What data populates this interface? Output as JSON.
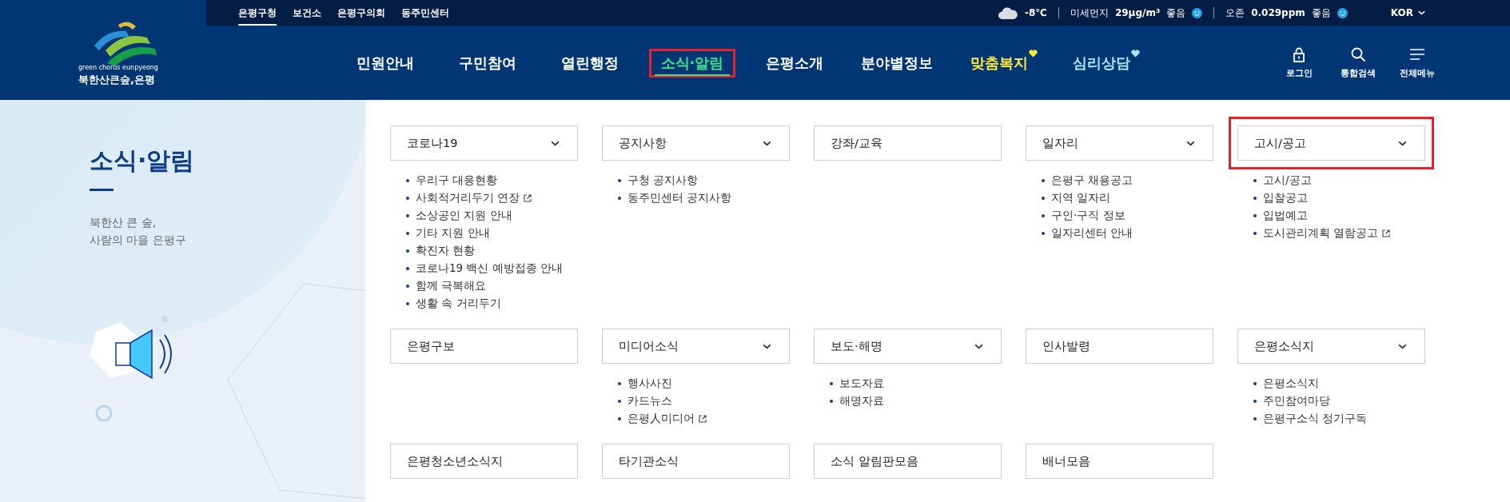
{
  "logo": {
    "tagline": "green chorus eunpyeong",
    "name": "북한산큰숲,은평"
  },
  "top_links": [
    {
      "label": "은평구청",
      "selected": true
    },
    {
      "label": "보건소",
      "selected": false
    },
    {
      "label": "은평구의회",
      "selected": false
    },
    {
      "label": "동주민센터",
      "selected": false
    }
  ],
  "status": {
    "temperature": "-8℃",
    "dust_label": "미세먼지",
    "dust_value": "29μg/m³",
    "dust_grade": "좋음",
    "ozone_label": "오존",
    "ozone_value": "0.029ppm",
    "ozone_grade": "좋음",
    "language": "KOR"
  },
  "nav": [
    {
      "label": "민원안내",
      "selected": false,
      "highlighted": false,
      "color": "#ffffff",
      "heart": false
    },
    {
      "label": "구민참여",
      "selected": false,
      "highlighted": false,
      "color": "#ffffff",
      "heart": false
    },
    {
      "label": "열린행정",
      "selected": false,
      "highlighted": false,
      "color": "#ffffff",
      "heart": false
    },
    {
      "label": "소식·알림",
      "selected": true,
      "highlighted": true,
      "color": "#3fe08c",
      "heart": false
    },
    {
      "label": "은평소개",
      "selected": false,
      "highlighted": false,
      "color": "#ffffff",
      "heart": false
    },
    {
      "label": "분야별정보",
      "selected": false,
      "highlighted": false,
      "color": "#ffffff",
      "heart": false
    },
    {
      "label": "맞춤복지",
      "selected": false,
      "highlighted": false,
      "color": "#ffe83a",
      "heart": true
    },
    {
      "label": "심리상담",
      "selected": false,
      "highlighted": false,
      "color": "#a8e6ff",
      "heart": true
    }
  ],
  "utilities": [
    {
      "kind": "lock",
      "label": "로그인"
    },
    {
      "kind": "search",
      "label": "통합검색"
    },
    {
      "kind": "menu",
      "label": "전체메뉴"
    }
  ],
  "section": {
    "title": "소식·알림",
    "subtitle_lines": [
      "북한산 큰 숲,",
      "사람의 마을 은평구"
    ]
  },
  "categories": [
    {
      "label": "코로나19",
      "expandable": true,
      "highlighted": false,
      "items": [
        {
          "label": "우리구 대응현황",
          "external": false
        },
        {
          "label": "사회적거리두기 연장",
          "external": true
        },
        {
          "label": "소상공인 지원 안내",
          "external": false
        },
        {
          "label": "기타 지원 안내",
          "external": false
        },
        {
          "label": "확진자 현황",
          "external": false
        },
        {
          "label": "코로나19 백신 예방접종 안내",
          "external": false
        },
        {
          "label": "함께 극복해요",
          "external": false
        },
        {
          "label": "생활 속 거리두기",
          "external": false
        }
      ]
    },
    {
      "label": "공지사항",
      "expandable": true,
      "highlighted": false,
      "items": [
        {
          "label": "구청 공지사항",
          "external": false
        },
        {
          "label": "동주민센터 공지사항",
          "external": false
        }
      ]
    },
    {
      "label": "강좌/교육",
      "expandable": false,
      "highlighted": false
    },
    {
      "label": "일자리",
      "expandable": true,
      "highlighted": false,
      "items": [
        {
          "label": "은평구 채용공고",
          "external": false
        },
        {
          "label": "지역 일자리",
          "external": false
        },
        {
          "label": "구인·구직 정보",
          "external": false
        },
        {
          "label": "일자리센터 안내",
          "external": false
        }
      ]
    },
    {
      "label": "고시/공고",
      "expandable": true,
      "highlighted": true,
      "items": [
        {
          "label": "고시/공고",
          "external": false
        },
        {
          "label": "입찰공고",
          "external": false
        },
        {
          "label": "입법예고",
          "external": false
        },
        {
          "label": "도시관리계획 열람공고",
          "external": true
        }
      ]
    },
    {
      "label": "은평구보",
      "expandable": false,
      "highlighted": false
    },
    {
      "label": "미디어소식",
      "expandable": true,
      "highlighted": false,
      "items": [
        {
          "label": "행사사진",
          "external": false
        },
        {
          "label": "카드뉴스",
          "external": false
        },
        {
          "label": "은평人미디어",
          "external": true
        }
      ]
    },
    {
      "label": "보도·해명",
      "expandable": true,
      "highlighted": false,
      "items": [
        {
          "label": "보도자료",
          "external": false
        },
        {
          "label": "해명자료",
          "external": false
        }
      ]
    },
    {
      "label": "인사발령",
      "expandable": false,
      "highlighted": false
    },
    {
      "label": "은평소식지",
      "expandable": true,
      "highlighted": false,
      "items": [
        {
          "label": "은평소식지",
          "external": false
        },
        {
          "label": "주민참여마당",
          "external": false
        },
        {
          "label": "은평구소식 정기구독",
          "external": false
        }
      ]
    },
    {
      "label": "은평청소년소식지",
      "expandable": false,
      "highlighted": false
    },
    {
      "label": "타기관소식",
      "expandable": false,
      "highlighted": false
    },
    {
      "label": "소식 알림판모음",
      "expandable": false,
      "highlighted": false
    },
    {
      "label": "배너모음",
      "expandable": false,
      "highlighted": false
    }
  ]
}
